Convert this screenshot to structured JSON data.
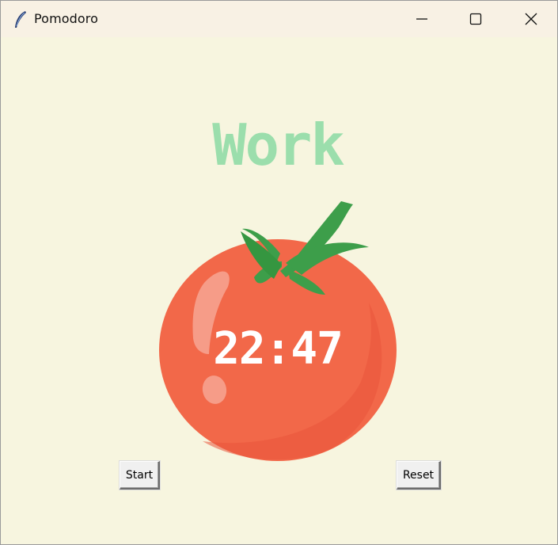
{
  "window": {
    "title": "Pomodoro",
    "app_icon": "feather-icon",
    "controls": {
      "minimize_icon": "minimize-icon",
      "maximize_icon": "maximize-icon",
      "close_icon": "close-icon"
    }
  },
  "main": {
    "mode_label": "Work",
    "timer": "22:47",
    "image": "tomato-image",
    "start_button": "Start",
    "reset_button": "Reset"
  },
  "colors": {
    "background": "#f7f5df",
    "mode_label": "#9bdeac",
    "tomato": "#f26849",
    "leaves": "#3d9e4a",
    "timer_text": "#ffffff"
  }
}
